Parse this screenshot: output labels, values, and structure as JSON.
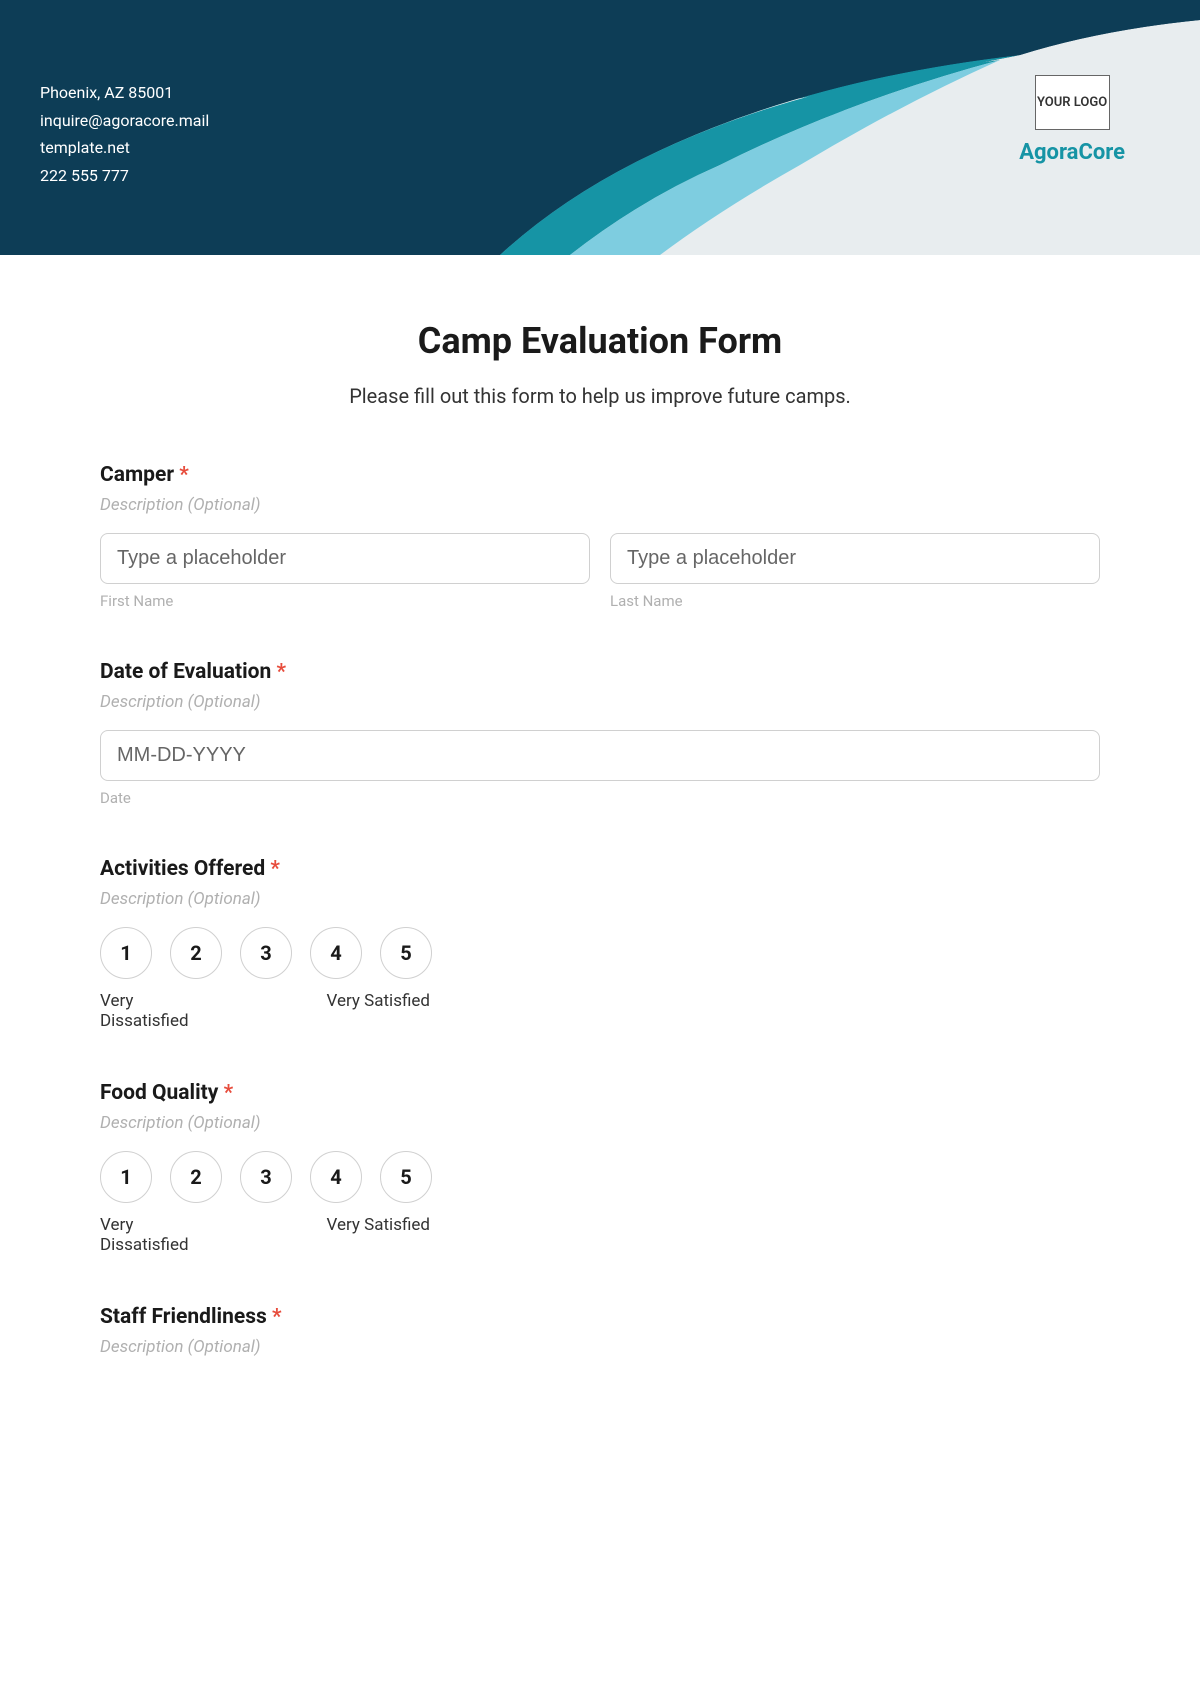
{
  "header": {
    "address": "Phoenix, AZ 85001",
    "email": "inquire@agoracore.mail",
    "website": "template.net",
    "phone": "222 555 777",
    "logo_text": "YOUR LOGO",
    "company_name": "AgoraCore"
  },
  "form": {
    "title": "Camp Evaluation Form",
    "subtitle": "Please fill out this form to help us improve future camps.",
    "fields": {
      "camper": {
        "label": "Camper",
        "description": "Description (Optional)",
        "first_name_placeholder": "Type a placeholder",
        "first_name_sublabel": "First Name",
        "last_name_placeholder": "Type a placeholder",
        "last_name_sublabel": "Last Name"
      },
      "date": {
        "label": "Date of Evaluation",
        "description": "Description (Optional)",
        "placeholder": "MM-DD-YYYY",
        "sublabel": "Date"
      },
      "activities": {
        "label": "Activities Offered",
        "description": "Description (Optional)",
        "ratings": [
          "1",
          "2",
          "3",
          "4",
          "5"
        ],
        "label_low": "Very Dissatisfied",
        "label_high": "Very Satisfied"
      },
      "food": {
        "label": "Food Quality",
        "description": "Description (Optional)",
        "ratings": [
          "1",
          "2",
          "3",
          "4",
          "5"
        ],
        "label_low": "Very Dissatisfied",
        "label_high": "Very Satisfied"
      },
      "staff": {
        "label": "Staff Friendliness",
        "description": "Description (Optional)"
      }
    },
    "required_marker": "*"
  }
}
